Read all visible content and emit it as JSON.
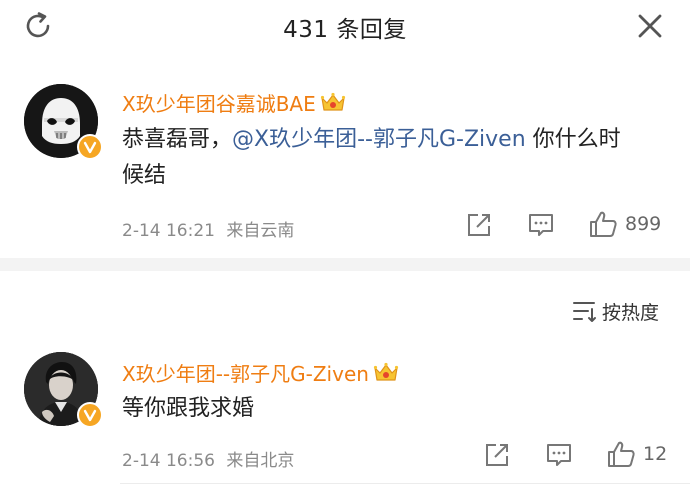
{
  "header": {
    "title": "431 条回复"
  },
  "comments": [
    {
      "username": "X玖少年团谷嘉诚BAE",
      "text_prefix": "恭喜磊哥，",
      "mention": "@X玖少年团--郭子凡G-Ziven",
      "text_suffix": " 你什么时候结",
      "time": "2-14 16:21",
      "location": "来自云南",
      "likes": "899"
    },
    {
      "username": "X玖少年团--郭子凡G-Ziven",
      "text": "等你跟我求婚",
      "time": "2-14 16:56",
      "location": "来自北京",
      "likes": "12"
    }
  ],
  "sort": {
    "label": "按热度"
  },
  "colors": {
    "username": "#ef7d12",
    "mention": "#3b5f97",
    "badge": "#f6a623"
  }
}
